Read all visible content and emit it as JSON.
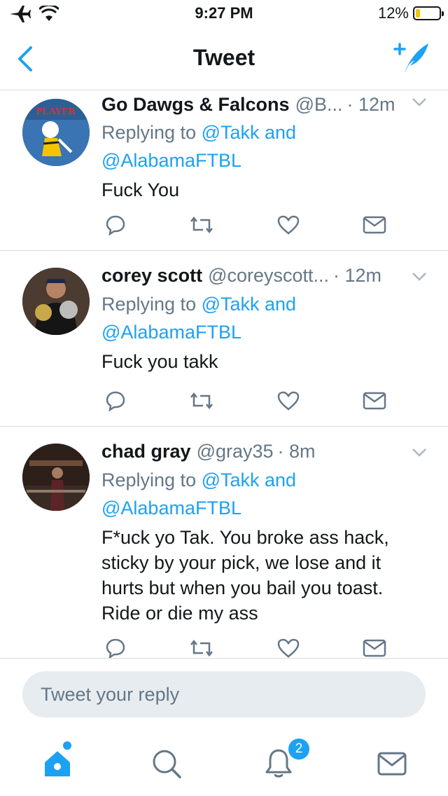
{
  "status": {
    "time": "9:27 PM",
    "battery": "12%",
    "battery_level": 0.12
  },
  "nav": {
    "title": "Tweet"
  },
  "tweets": [
    {
      "name": "Go Dawgs &  Falcons",
      "handle": "@B...",
      "time": "· 12m",
      "replying_prefix": "Replying to ",
      "replying_first": "@Takk and",
      "replying_second": "@AlabamaFTBL",
      "text": "Fuck You",
      "avatar_label": "PLAYER"
    },
    {
      "name": "corey scott",
      "handle": "@coreyscott...",
      "time": "· 12m",
      "replying_prefix": "Replying to ",
      "replying_first": "@Takk and",
      "replying_second": "@AlabamaFTBL",
      "text": "Fuck you takk"
    },
    {
      "name": "chad gray",
      "handle": "@gray35",
      "time": "· 8m",
      "replying_prefix": "Replying to ",
      "replying_first": "@Takk and",
      "replying_second": "@AlabamaFTBL",
      "text_lines": [
        "F*uck yo Tak.  You broke ass hack,",
        "sticky by your pick, we lose and it",
        "hurts but when you bail you toast.",
        "Ride or die my ass"
      ]
    }
  ],
  "reply": {
    "placeholder": "Tweet your reply"
  },
  "tabbar": {
    "notifications_badge": "2"
  },
  "icons": {
    "back": "chevron-left-icon",
    "compose": "compose-tweet-icon",
    "reply": "reply-icon",
    "retweet": "retweet-icon",
    "like": "heart-icon",
    "dm": "envelope-icon",
    "home": "home-icon",
    "search": "search-icon",
    "notifications": "bell-icon",
    "messages": "envelope-icon"
  },
  "colors": {
    "accent": "#1da1f2",
    "secondary_text": "#657786",
    "divider": "#d8dde2",
    "battery": "#f5c400"
  }
}
